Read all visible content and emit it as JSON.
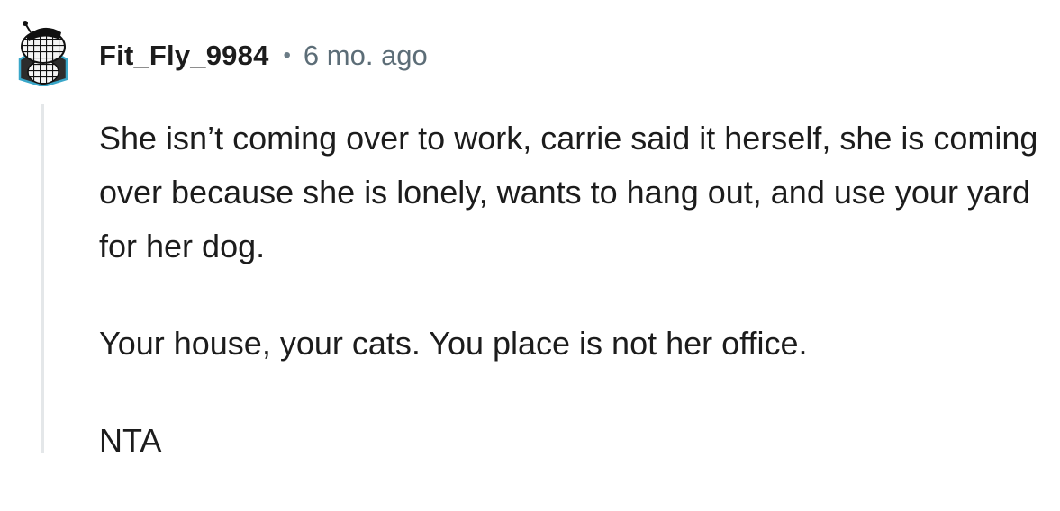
{
  "comment": {
    "author": "Fit_Fly_9984",
    "separator": "•",
    "timestamp": "6 mo. ago",
    "avatar_icon": "snoo-avatar-icon",
    "paragraphs": [
      "She isn’t coming over to work, carrie said it herself, she is coming over because she is lonely, wants to hang out, and use your yard for her dog.",
      "Your house, your cats. You place is not her office.",
      "NTA"
    ]
  },
  "colors": {
    "text": "#1c1c1c",
    "meta": "#5c6d77",
    "thread_line": "#e4e7e9",
    "avatar_accent": "#3aa7c9"
  }
}
